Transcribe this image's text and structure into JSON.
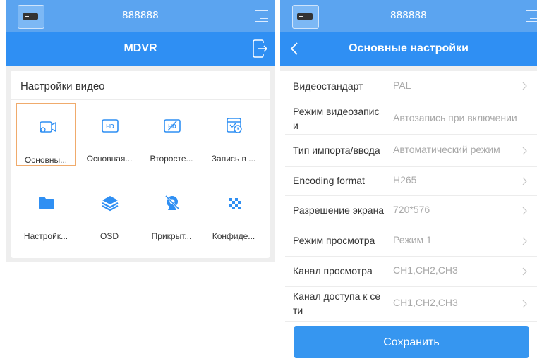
{
  "left": {
    "status_number": "888888",
    "title": "MDVR",
    "section_title": "Настройки видео",
    "tiles": [
      {
        "label": "Основны...",
        "icon": "camera-settings-icon",
        "selected": true
      },
      {
        "label": "Основная...",
        "icon": "hd-icon",
        "selected": false
      },
      {
        "label": "Второсте...",
        "icon": "hd-off-icon",
        "selected": false
      },
      {
        "label": "Запись в ...",
        "icon": "schedule-record-icon",
        "selected": false
      },
      {
        "label": "Настройк...",
        "icon": "folder-icon",
        "selected": false
      },
      {
        "label": "OSD",
        "icon": "layers-icon",
        "selected": false
      },
      {
        "label": "Прикрыт...",
        "icon": "camera-blocked-icon",
        "selected": false
      },
      {
        "label": "Конфиде...",
        "icon": "mosaic-icon",
        "selected": false
      }
    ]
  },
  "right": {
    "status_number": "888888",
    "title": "Основные настройки",
    "rows": [
      {
        "key": "Видеостандарт",
        "value": "PAL"
      },
      {
        "key_line1": "Режим видеозапис",
        "key_line2": "и",
        "value": "Автозапись при включении"
      },
      {
        "key": "Тип импорта/ввода",
        "value": "Автоматический режим"
      },
      {
        "key": "Encoding format",
        "value": "H265"
      },
      {
        "key": "Разрешение экрана",
        "value": "720*576"
      },
      {
        "key": "Режим просмотра",
        "value": "Режим 1"
      },
      {
        "key": "Канал просмотра",
        "value": "CH1,CH2,CH3"
      },
      {
        "key_line1": "Канал доступа к се",
        "key_line2": "ти",
        "value": "CH1,CH2,CH3"
      }
    ],
    "save_label": "Сохранить"
  },
  "colors": {
    "status_bar": "#5ba4f0",
    "title_bar": "#2f8ff3",
    "icon_blue": "#2f8ff3",
    "selection_border": "#f0ab6c",
    "value_gray": "#a9a9a9",
    "save_button": "#3696f0"
  }
}
